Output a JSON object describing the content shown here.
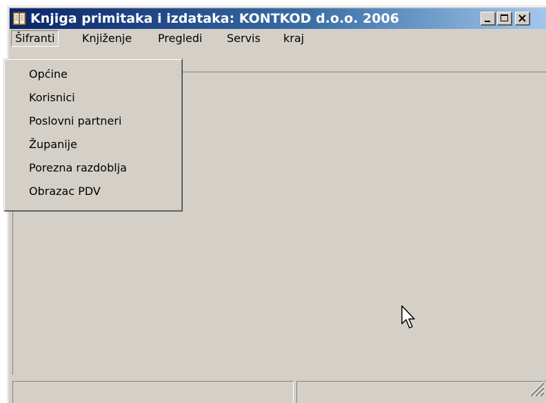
{
  "window": {
    "title": "Knjiga primitaka i izdataka: KONTKOD d.o.o. 2006",
    "icon": "book-icon",
    "controls": {
      "minimize_icon": "minimize-icon",
      "maximize_icon": "maximize-icon",
      "close_icon": "close-icon"
    }
  },
  "menubar": {
    "items": [
      {
        "label": "Šifranti",
        "open": true
      },
      {
        "label": "Knjiženje"
      },
      {
        "label": "Pregledi"
      },
      {
        "label": "Servis"
      },
      {
        "label": "kraj"
      }
    ]
  },
  "dropdown": {
    "items": [
      {
        "label": "Općine"
      },
      {
        "label": "Korisnici"
      },
      {
        "label": "Poslovni partneri"
      },
      {
        "label": "Županije"
      },
      {
        "label": "Porezna razdoblja"
      },
      {
        "label": "Obrazac PDV"
      }
    ]
  },
  "statusbar": {
    "panels": [
      {
        "text": ""
      },
      {
        "text": ""
      }
    ]
  },
  "colors": {
    "face": "#d4d0c8",
    "title_start": "#0a246a",
    "title_end": "#a6caf0"
  }
}
